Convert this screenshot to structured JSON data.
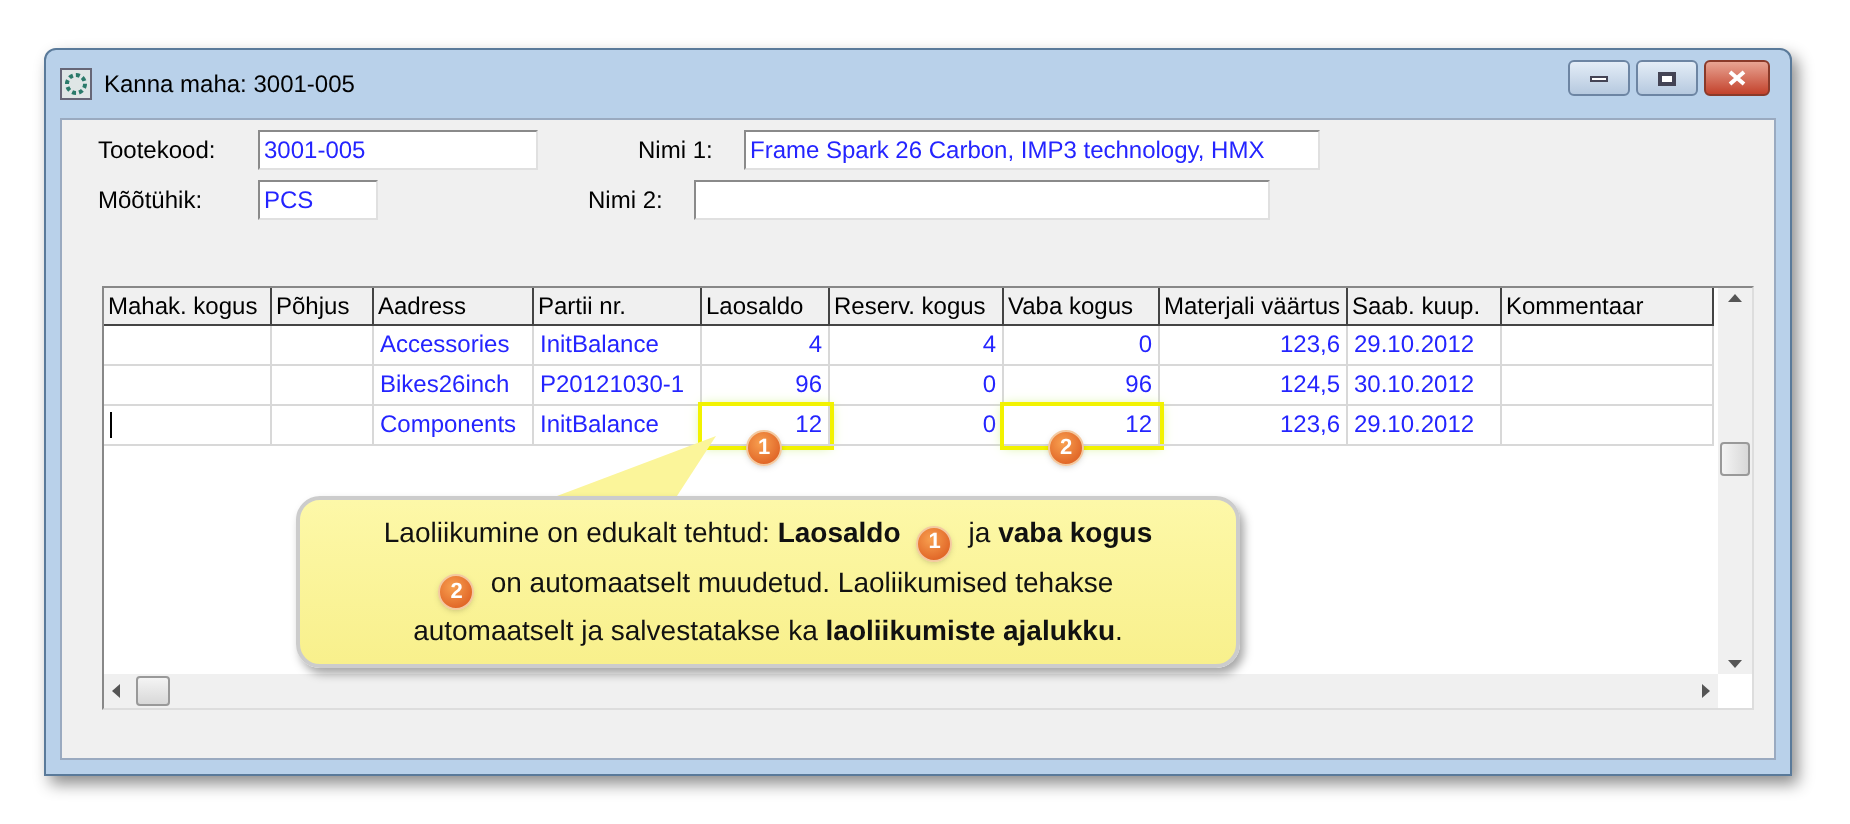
{
  "window": {
    "title": "Kanna maha: 3001-005"
  },
  "fields": [
    {
      "label": "Tootekood:",
      "value": "3001-005"
    },
    {
      "label": "Nimi 1:",
      "value": "Frame Spark 26 Carbon, IMP3 technology, HMX"
    },
    {
      "label": "Mõõtühik:",
      "value": "PCS"
    },
    {
      "label": "Nimi 2:"
    }
  ],
  "table": {
    "columns": [
      "Mahak. kogus",
      "Põhjus",
      "Aadress",
      "Partii nr.",
      "Laosaldo",
      "Reserv. kogus",
      "Vaba kogus",
      "Materjali väärtus",
      "Saab. kuup.",
      "Kommentaar"
    ],
    "rows": [
      {
        "editing": false,
        "cells": [
          "",
          "",
          "Accessories",
          "InitBalance",
          "4",
          "4",
          "0",
          "123,6",
          "29.10.2012",
          ""
        ]
      },
      {
        "editing": false,
        "cells": [
          "",
          "",
          "Bikes26inch",
          "P20121030-1",
          "96",
          "0",
          "96",
          "124,5",
          "30.10.2012",
          ""
        ]
      },
      {
        "editing": true,
        "cells": [
          "",
          "",
          "Components",
          "InitBalance",
          {
            "text": "12",
            "marker": "1"
          },
          "0",
          {
            "text": "12",
            "marker": "2"
          },
          "123,6",
          "29.10.2012",
          ""
        ]
      }
    ]
  },
  "callout": {
    "parts": [
      {
        "kind": "text",
        "text": "Laoliikumine on edukalt tehtud: **Laosaldo**"
      },
      {
        "kind": "badge",
        "label": "1"
      },
      {
        "kind": "text",
        "text": "ja **vaba kogus**"
      },
      {
        "kind": "badge",
        "label": "2"
      },
      {
        "kind": "text",
        "text": "on automaatselt muudetud. Laoliikumised tehakse automaatselt ja salvestatakse ka **laoliikumiste ajalukku**."
      }
    ]
  }
}
